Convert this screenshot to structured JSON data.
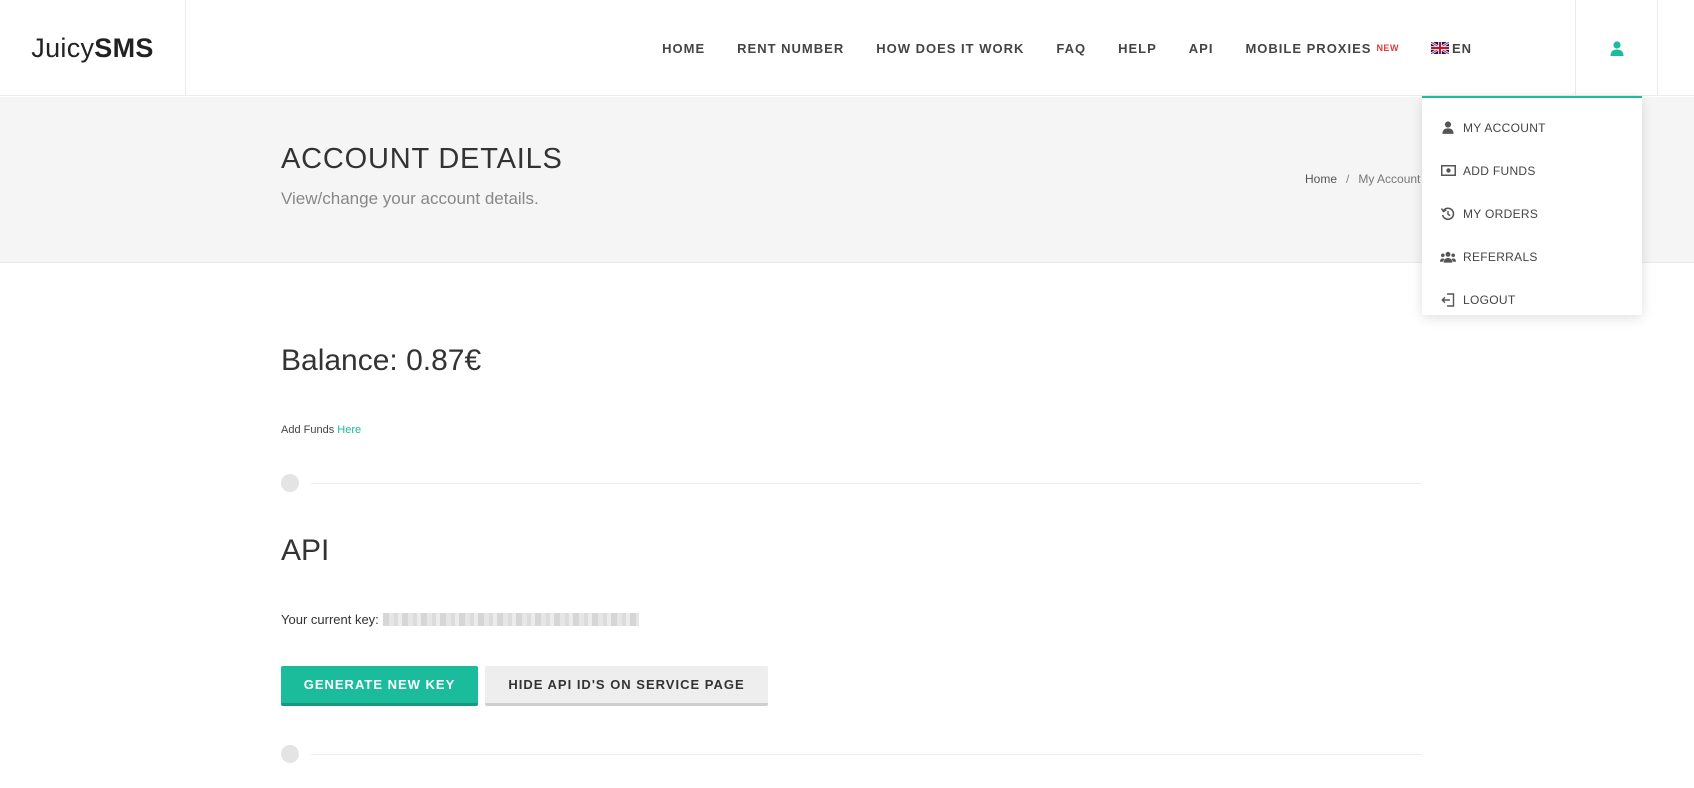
{
  "brand": {
    "logo_light": "Juicy",
    "logo_bold": "SMS"
  },
  "nav": {
    "items": [
      "HOME",
      "RENT NUMBER",
      "HOW DOES IT WORK",
      "FAQ",
      "HELP",
      "API"
    ],
    "mobile_proxies": "MOBILE PROXIES",
    "new_badge": "NEW",
    "language": "EN"
  },
  "header": {
    "title": "ACCOUNT DETAILS",
    "subtitle": "View/change your account details.",
    "breadcrumb": {
      "home": "Home",
      "separator": "/",
      "current": "My Account"
    }
  },
  "dropdown": {
    "items": [
      {
        "label": "MY ACCOUNT",
        "icon": "user-icon"
      },
      {
        "label": "ADD FUNDS",
        "icon": "money-icon"
      },
      {
        "label": "MY ORDERS",
        "icon": "history-icon"
      },
      {
        "label": "REFERRALS",
        "icon": "users-icon"
      },
      {
        "label": "LOGOUT",
        "icon": "logout-icon"
      }
    ]
  },
  "balance": {
    "text": "Balance: 0.87€",
    "add_funds_prefix": "Add Funds",
    "add_funds_link": "Here"
  },
  "api": {
    "title": "API",
    "key_label": "Your current key:",
    "generate_button": "GENERATE NEW KEY",
    "hide_button": "HIDE API ID'S ON SERVICE PAGE"
  },
  "colors": {
    "accent": "#1abc9c",
    "new_badge": "#e03c3c"
  }
}
